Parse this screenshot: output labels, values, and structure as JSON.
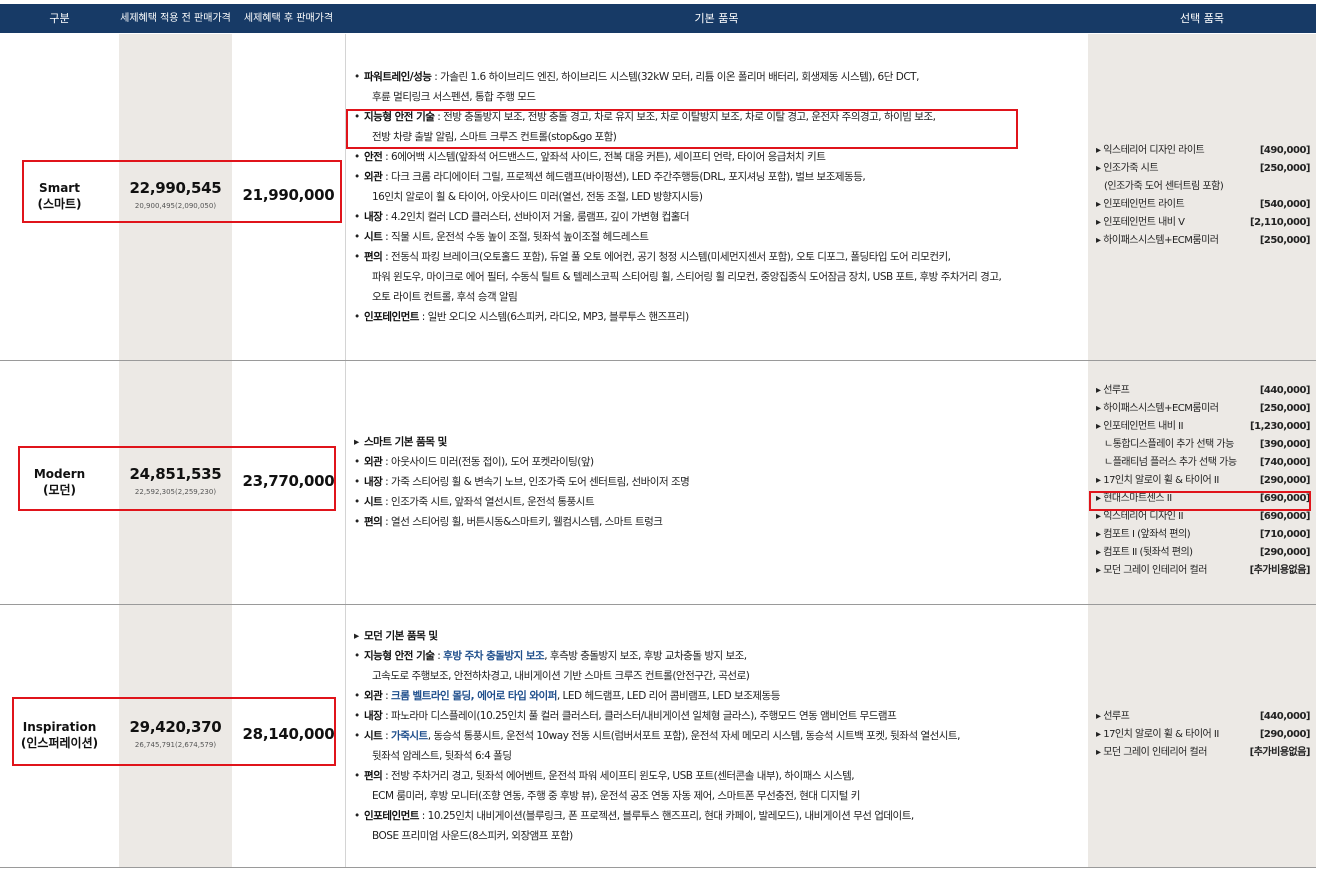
{
  "header": {
    "gubun": "구분",
    "before_price": "세제혜택 적용 전 판매가격",
    "after_price": "세제혜택 후 판매가격",
    "basic": "기본 품목",
    "options": "선택 품목"
  },
  "rows": [
    {
      "trim_en": "Smart",
      "trim_ko": "(스마트)",
      "price_before": "22,990,545",
      "price_before_detail": "20,900,495(2,090,050)",
      "price_after": "21,990,000",
      "basic": [
        {
          "label": "파워트레인/성능",
          "text": " : 가솔린 1.6 하이브리드 엔진, 하이브리드 시스템(32kW 모터, 리튬 이온 폴리머 배터리, 회생제동 시스템), 6단 DCT,"
        },
        {
          "text": "후륜 멀티링크 서스펜션, 통합 주행 모드"
        },
        {
          "label": "지능형 안전 기술",
          "text": " : 전방 충돌방지 보조, 전방 충돌 경고, 차로 유지 보조, 차로 이탈방지 보조, 차로 이탈 경고, 운전자 주의경고, 하이빔 보조,"
        },
        {
          "text": "전방 차량 출발 알림, 스마트 크루즈 컨트롤(stop&go 포함)"
        },
        {
          "label": "안전",
          "text": " : 6에어백 시스템(앞좌석 어드밴스드, 앞좌석 사이드, 전복 대응 커튼), 세이프티 언락, 타이어 응급처치 키트"
        },
        {
          "label": "외관",
          "text": " : 다크 크롬 라디에이터 그릴, 프로젝션 헤드램프(바이펑션), LED 주간주행등(DRL, 포지셔닝 포함), 벌브 보조제동등,"
        },
        {
          "text": "16인치 알로이 휠 & 타이어, 아웃사이드 미러(열선, 전동 조절, LED 방향지시등)"
        },
        {
          "label": "내장",
          "text": " : 4.2인치 컬러 LCD 클러스터, 선바이저 거울, 룸램프, 깊이 가변형 컵홀더"
        },
        {
          "label": "시트",
          "text": " : 직물 시트, 운전석 수동 높이 조절, 뒷좌석 높이조절 헤드레스트"
        },
        {
          "label": "편의",
          "text": " : 전동식 파킹 브레이크(오토홀드 포함), 듀얼 풀 오토 에어컨, 공기 청정 시스템(미세먼지센서 포함), 오토 디포그, 폴딩타입 도어 리모컨키,"
        },
        {
          "text": "파워 윈도우, 마이크로 에어 필터, 수동식 틸트 & 텔레스코픽 스티어링 휠, 스티어링 휠 리모컨, 중앙집중식 도어잠금 장치, USB 포트, 후방 주차거리 경고,"
        },
        {
          "text": "오토 라이트 컨트롤, 후석 승객 알림"
        },
        {
          "label": "인포테인먼트",
          "text": " : 일반 오디오 시스템(6스피커, 라디오, MP3, 블루투스 핸즈프리)"
        }
      ],
      "options": [
        {
          "name": "익스테리어 디자인 라이트",
          "price": "[490,000]"
        },
        {
          "name": "인조가죽 시트",
          "price": "[250,000]"
        },
        {
          "name": "(인조가죽 도어 센터트림 포함)",
          "price": "",
          "sub": true
        },
        {
          "name": "인포테인먼트 라이트",
          "price": "[540,000]"
        },
        {
          "name": "인포테인먼트 내비 V",
          "price": "[2,110,000]"
        },
        {
          "name": "하이패스시스템+ECM룸미러",
          "price": "[250,000]"
        }
      ]
    },
    {
      "trim_en": "Modern",
      "trim_ko": "(모던)",
      "price_before": "24,851,535",
      "price_before_detail": "22,592,305(2,259,230)",
      "price_after": "23,770,000",
      "basic": [
        {
          "label": "스마트 기본 품목 및",
          "text": "",
          "arrow": true
        },
        {
          "label": "외관",
          "text": " : 아웃사이드 미러(전동 접이), 도어 포켓라이팅(앞)"
        },
        {
          "label": "내장",
          "text": " : 가죽 스티어링 휠 & 변속기 노브, 인조가죽 도어 센터트림, 선바이저 조명"
        },
        {
          "label": "시트",
          "text": " : 인조가죽 시트, 앞좌석 열선시트, 운전석 통풍시트"
        },
        {
          "label": "편의",
          "text": " : 열선 스티어링 휠, 버튼시동&스마트키, 웰컴시스템, 스마트 트렁크"
        }
      ],
      "options": [
        {
          "name": "선루프",
          "price": "[440,000]"
        },
        {
          "name": "하이패스시스템+ECM룸미러",
          "price": "[250,000]"
        },
        {
          "name": "인포테인먼트 내비 II",
          "price": "[1,230,000]"
        },
        {
          "name": "ㄴ통합디스플레이 추가 선택 가능",
          "price": "[390,000]",
          "sub": true
        },
        {
          "name": "ㄴ플래티넘 플러스 추가 선택 가능",
          "price": "[740,000]",
          "sub": true
        },
        {
          "name": "17인치 알로이 휠 & 타이어 II",
          "price": "[290,000]"
        },
        {
          "name": "현대스마트센스 II",
          "price": "[690,000]"
        },
        {
          "name": "익스테리어 디자인 II",
          "price": "[690,000]"
        },
        {
          "name": "컴포트 I (앞좌석 편의)",
          "price": "[710,000]"
        },
        {
          "name": "컴포트 II (뒷좌석 편의)",
          "price": "[290,000]"
        },
        {
          "name": "모던 그레이 인테리어 컬러",
          "price": "[추가비용없음]"
        }
      ]
    },
    {
      "trim_en": "Inspiration",
      "trim_ko": "(인스퍼레이션)",
      "price_before": "29,420,370",
      "price_before_detail": "26,745,791(2,674,579)",
      "price_after": "28,140,000",
      "basic": [
        {
          "label": "모던 기본 품목 및",
          "text": "",
          "arrow": true
        },
        {
          "label": "지능형 안전 기술",
          "text": " : ",
          "blue": "후방 주차 충돌방지 보조",
          "rest": ", 후측방 충돌방지 보조, 후방 교차충돌 방지 보조,"
        },
        {
          "text": "고속도로 주행보조, 안전하차경고, 내비게이션 기반 스마트 크루즈 컨트롤(안전구간, 곡선로)"
        },
        {
          "label": "외관",
          "text": " : ",
          "blue": "크롬 벨트라인 몰딩, 에어로 타입 와이퍼",
          "rest": ", LED 헤드램프, LED 리어 콤비램프, LED 보조제동등"
        },
        {
          "label": "내장",
          "text": " : 파노라마 디스플레이(10.25인치 풀 컬러 클러스터, 클러스터/내비게이션 일체형 글라스), 주행모드 연동 앰비언트 무드램프"
        },
        {
          "label": "시트",
          "text": " : ",
          "blue": "가죽시트",
          "rest": ", 동승석 통풍시트, 운전석 10way 전동 시트(럼버서포트 포함), 운전석 자세 메모리 시스템, 동승석 시트백 포켓, 뒷좌석 열선시트,"
        },
        {
          "text": "뒷좌석 암레스트, 뒷좌석 6:4 폴딩"
        },
        {
          "label": "편의",
          "text": " : 전방 주차거리 경고, 뒷좌석 에어벤트, 운전석 파워 세이프티 윈도우, USB 포트(센터콘솔 내부), 하이패스 시스템,"
        },
        {
          "text": "ECM 룸미러, 후방 모니터(조향 연동, 주행 중 후방 뷰), 운전석 공조 연동 자동 제어, 스마트폰 무선충전, 현대 디지털 키"
        },
        {
          "label": "인포테인먼트",
          "text": " : 10.25인치 내비게이션(블루링크, 폰 프로젝션, 블루투스 핸즈프리, 현대 카페이, 발레모드), 내비게이션 무선 업데이트,"
        },
        {
          "text": "BOSE 프리미엄 사운드(8스피커, 외장앰프 포함)"
        }
      ],
      "options": [
        {
          "name": "선루프",
          "price": "[440,000]"
        },
        {
          "name": "17인치 알로이 휠 & 타이어 II",
          "price": "[290,000]"
        },
        {
          "name": "모던 그레이 인테리어 컬러",
          "price": "[추가비용없음]"
        }
      ]
    }
  ],
  "colors": {
    "header_bg": "#173a66",
    "highlight": "#e0141b",
    "cell_gray": "#ece9e5"
  }
}
